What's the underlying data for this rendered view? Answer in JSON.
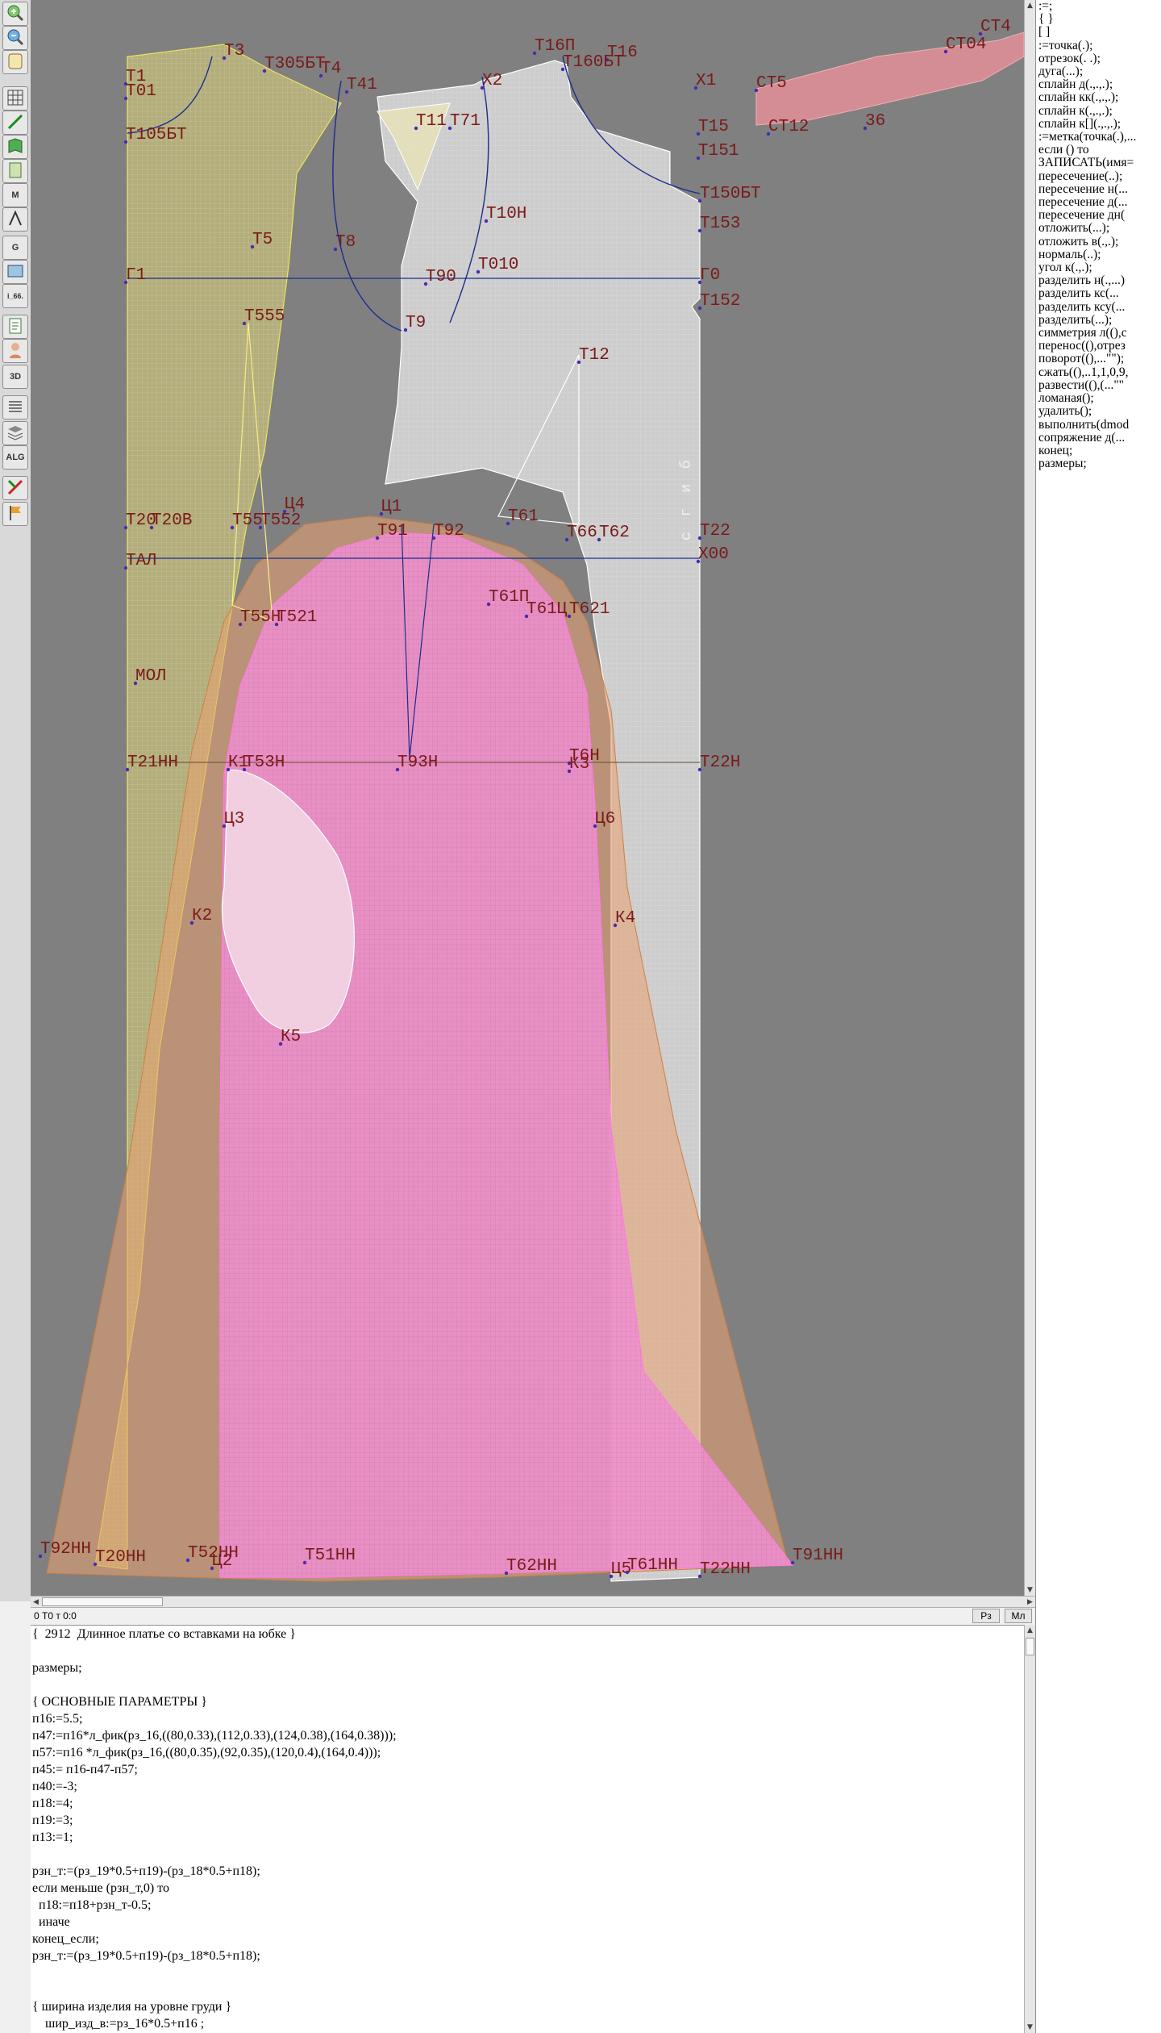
{
  "toolbar": {
    "buttons": [
      {
        "icon": "zoom-in-icon",
        "label": ""
      },
      {
        "icon": "zoom-out-icon",
        "label": ""
      },
      {
        "icon": "scroll-icon",
        "label": ""
      },
      {
        "icon": "grid-icon",
        "label": ""
      },
      {
        "icon": "line-tool-icon",
        "label": ""
      },
      {
        "icon": "book-icon",
        "label": ""
      },
      {
        "icon": "document-icon",
        "label": ""
      },
      {
        "icon": "m-tool-icon",
        "label": "M"
      },
      {
        "icon": "measure-icon",
        "label": ""
      },
      {
        "icon": "g-tool-icon",
        "label": "G"
      },
      {
        "icon": "blueprint-icon",
        "label": ""
      },
      {
        "icon": "file-label-icon",
        "label": "i_66."
      },
      {
        "icon": "page-icon",
        "label": ""
      },
      {
        "icon": "mannequin-icon",
        "label": ""
      },
      {
        "icon": "3d-icon",
        "label": "3D"
      },
      {
        "icon": "layers-icon",
        "label": ""
      },
      {
        "icon": "stack-icon",
        "label": ""
      },
      {
        "icon": "alg-icon",
        "label": "ALG"
      },
      {
        "icon": "cut-icon",
        "label": ""
      },
      {
        "icon": "flag-icon",
        "label": ""
      }
    ]
  },
  "canvas": {
    "vertical_text": "с г и б",
    "point_labels": [
      "Т1",
      "Т01",
      "Т3",
      "Т305БТ",
      "Т4",
      "Т41",
      "Х2",
      "Х1",
      "Т16П",
      "Т16",
      "Т160БТ",
      "Т105БТ",
      "Т11",
      "Т71",
      "Т15",
      "Т151",
      "Т150БТ",
      "Т153",
      "Т10Н",
      "Т5",
      "Т8",
      "Г1",
      "Т90",
      "Т010",
      "Г0",
      "Т152",
      "Т555",
      "Т9",
      "Т12",
      "Т20",
      "Т20В",
      "Т55",
      "Т552",
      "Ц4",
      "Ц1",
      "Т91",
      "Т92",
      "Т61",
      "Т66",
      "Т62",
      "Т22",
      "ТАЛ",
      "Х00",
      "Т61П",
      "Т61Ц",
      "Т621",
      "Т55Н",
      "Т521",
      "МОЛ",
      "Т21НН",
      "К1",
      "Т53Н",
      "Т93Н",
      "Т6Н",
      "К3",
      "Т22Н",
      "Ц3",
      "Ц6",
      "К2",
      "К4",
      "К5",
      "Т92НН",
      "Т20НН",
      "Т52НН",
      "Ц2",
      "Т51НН",
      "Т62НН",
      "Ц5",
      "Т61НН",
      "Т22НН",
      "Т91НН",
      "СТ5",
      "СТ4",
      "СТ04",
      "СТ12",
      "36"
    ]
  },
  "command_panel": {
    "items": [
      ":=;",
      "{ }",
      "[ ]",
      ":=точка(.);",
      "отрезок(. .);",
      "дуга(...);",
      "сплайн д(.,.,.);",
      "сплайн кк(.,.,.);",
      "сплайн к(.,.,.);",
      "сплайн к[](.,.,.);",
      ":=метка(точка(.),...",
      "если () то",
      "ЗАПИСАТЬ(имя=",
      "пересечение(..);",
      "пересечение н(...",
      "пересечение д(...",
      "пересечение дн(",
      "отложить(...);",
      "отложить в(.,.);",
      "нормаль(..);",
      "угол к(.,.);",
      "разделить н(.,...)",
      "разделить кс(...",
      "разделить ксу(...",
      "разделить(...);",
      "симметрия л((),с",
      "перенос((),отрез",
      "поворот((),...\"\");",
      "сжать((),..1,1,0,9,",
      "развести((),(...\"\"",
      "ломаная();",
      "удалить();",
      "выполнить(dmod",
      "сопряжение д(...",
      "конец;",
      "размеры;"
    ]
  },
  "status": {
    "coords": "0  Т0 т 0:0",
    "btn_rz": "Рз",
    "btn_ml": "Мл"
  },
  "editor": {
    "lines": [
      "{  2912  Длинное платье со вставками на юбке }",
      "",
      "размеры;",
      "",
      "{ ОСНОВНЫЕ ПАРАМЕТРЫ }",
      "п16:=5.5;",
      "п47:=п16*л_фик(рз_16,((80,0.33),(112,0.33),(124,0.38),(164,0.38)));",
      "п57:=п16 *л_фик(рз_16,((80,0.35),(92,0.35),(120,0.4),(164,0.4)));",
      "п45:= п16-п47-п57;",
      "п40:=-3;",
      "п18:=4;",
      "п19:=3;",
      "п13:=1;",
      "",
      "рзн_т:=(рз_19*0.5+п19)-(рз_18*0.5+п18);",
      "если меньше (рзн_т,0) то",
      "  п18:=п18+рзн_т-0.5;",
      "  иначе",
      "конец_если;",
      "рзн_т:=(рз_19*0.5+п19)-(рз_18*0.5+п18);",
      "",
      "",
      "{ ширина изделия на уровне груди }",
      "    шир_изд_в:=рз_16*0.5+п16 ;"
    ]
  },
  "colors": {
    "canvas_bg": "#808080",
    "back_piece": "#b8b37a",
    "front_piece": "#d4d4d4",
    "skirt_insert": "#f08fd0",
    "side_panel": "#e8a070",
    "label_color": "#7a1a1a",
    "guide_line": "#1c2e8c"
  }
}
